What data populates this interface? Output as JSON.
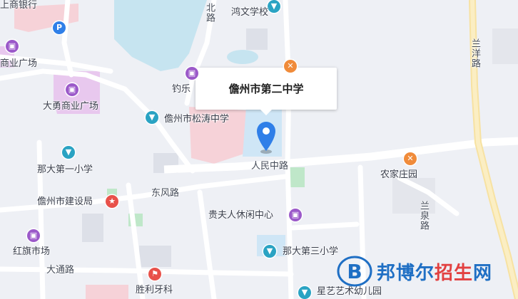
{
  "map": {
    "callout_title": "儋州市第二中学",
    "labels": {
      "bank": "上商银行",
      "hongwen": "鸿文学校",
      "shangye_top": "商业广场",
      "dayong": "大勇商业广场",
      "diaole": "钓乐",
      "songtao": "儋州市松涛中学",
      "nada1": "那大第一小学",
      "dongfeng": "东风路",
      "jianshe": "儋州市建设局",
      "guifuren": "贵夫人休闲中心",
      "hongqi": "红旗市场",
      "nada3": "那大第三小学",
      "datong": "大通路",
      "shengli": "胜利牙科",
      "xingyi": "星艺艺术幼儿园",
      "nongjia": "农家庄园",
      "renmin": "人民中路",
      "lanyang": "兰洋路",
      "lanquan": "兰泉路",
      "beilu": "北路"
    },
    "icons": {
      "parking": "P",
      "shop": "bag-icon",
      "school": "school-icon",
      "food": "fork-icon",
      "gov": "flag-icon",
      "clinic": "clinic-icon"
    }
  },
  "watermark": {
    "part1": "邦博尔",
    "part2": "招生",
    "part3": "网",
    "logo_letter": "B"
  },
  "colors": {
    "background": "#eef0f5",
    "water": "#c6e4f0",
    "pink_area": "#f6d2d8",
    "highlight_area": "#cfe6f6",
    "main_road": "#fbe6a0",
    "pin": "#2f7fe8",
    "brand_blue": "#1f6fc4",
    "brand_red": "#e24040"
  }
}
